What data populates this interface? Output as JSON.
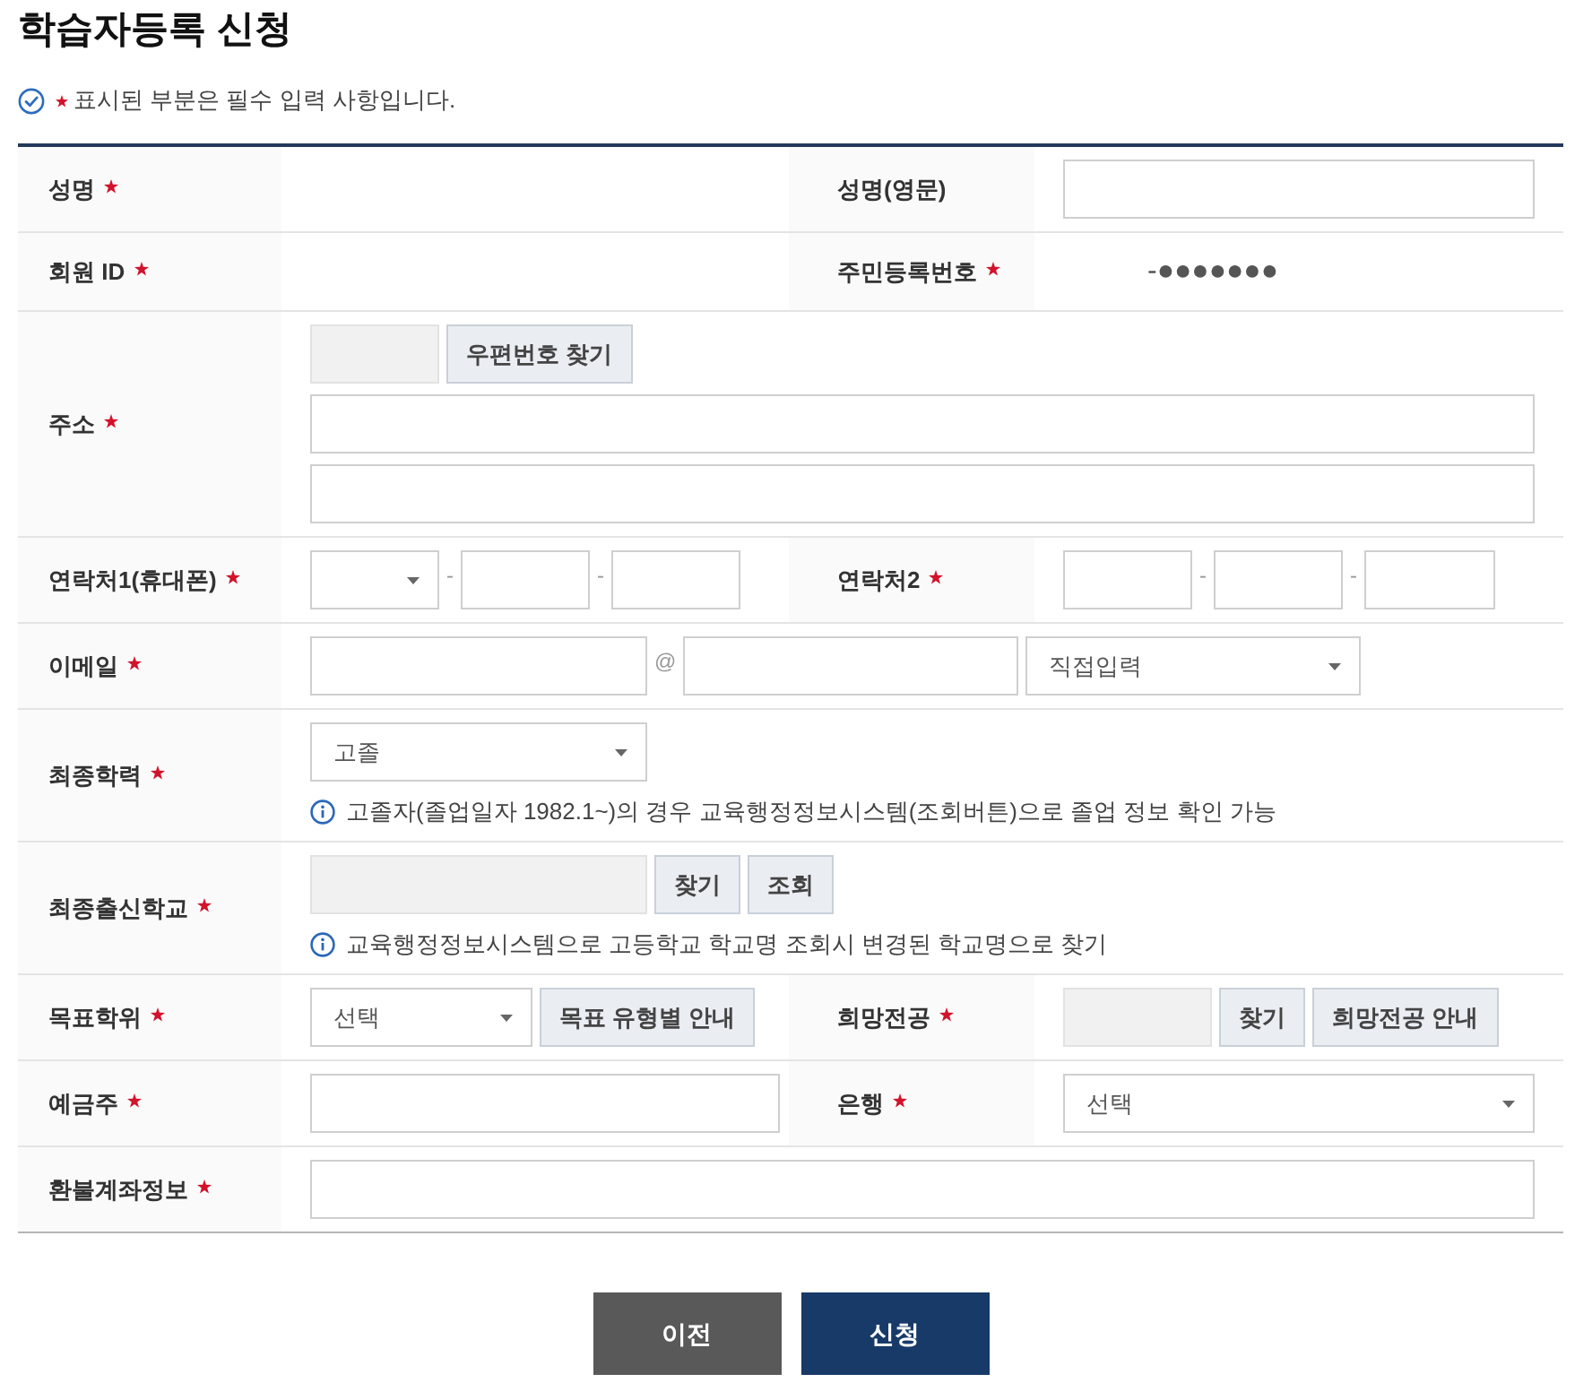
{
  "title": "학습자등록 신청",
  "notice": "표시된 부분은 필수 입력 사항입니다.",
  "rows": [
    {
      "fields": [
        {
          "label": "성명",
          "required": true
        },
        {
          "label": "성명(영문)",
          "required": false,
          "lines": [
            [
              {
                "kind": "input",
                "disabled": false
              }
            ]
          ]
        }
      ]
    },
    {
      "fields": [
        {
          "label": "회원 ID",
          "required": true
        },
        {
          "label": "주민등록번호",
          "required": true,
          "lines": [
            [
              {
                "kind": "text",
                "text": "-●●●●●●●"
              }
            ]
          ]
        }
      ]
    },
    {
      "fields": [
        {
          "label": "주소",
          "required": true,
          "lines": [
            [
              {
                "kind": "input",
                "disabled": true
              },
              {
                "kind": "button",
                "label": "우편번호 찾기"
              }
            ],
            [
              {
                "kind": "input",
                "disabled": false
              }
            ],
            [
              {
                "kind": "input",
                "disabled": false
              }
            ]
          ]
        }
      ]
    },
    {
      "fields": [
        {
          "label": "연락처1(휴대폰)",
          "required": true,
          "lines": [
            [
              {
                "kind": "select"
              },
              {
                "kind": "separator",
                "text": "-"
              },
              {
                "kind": "input",
                "disabled": false
              },
              {
                "kind": "separator",
                "text": "-"
              },
              {
                "kind": "input",
                "disabled": false
              }
            ]
          ]
        },
        {
          "label": "연락처2",
          "required": true,
          "lines": [
            [
              {
                "kind": "input",
                "disabled": false
              },
              {
                "kind": "separator",
                "text": "-"
              },
              {
                "kind": "input",
                "disabled": false
              },
              {
                "kind": "separator",
                "text": "-"
              },
              {
                "kind": "input",
                "disabled": false
              }
            ]
          ]
        }
      ]
    },
    {
      "fields": [
        {
          "label": "이메일",
          "required": true,
          "lines": [
            [
              {
                "kind": "input",
                "disabled": false
              },
              {
                "kind": "separator",
                "text": "@"
              },
              {
                "kind": "input",
                "disabled": false
              },
              {
                "kind": "select",
                "value": "직접입력"
              }
            ]
          ]
        }
      ]
    },
    {
      "fields": [
        {
          "label": "최종학력",
          "required": true,
          "lines": [
            [
              {
                "kind": "select",
                "value": "고졸"
              }
            ]
          ],
          "note": "고졸자(졸업일자 1982.1~)의 경우 교육행정정보시스템(조회버튼)으로 졸업 정보 확인 가능"
        }
      ]
    },
    {
      "fields": [
        {
          "label": "최종출신학교",
          "required": true,
          "lines": [
            [
              {
                "kind": "input",
                "disabled": true
              },
              {
                "kind": "button",
                "label": "찾기"
              },
              {
                "kind": "button",
                "label": "조회"
              }
            ]
          ],
          "note": "교육행정정보시스템으로 고등학교 학교명 조회시 변경된 학교명으로 찾기"
        }
      ]
    },
    {
      "fields": [
        {
          "label": "목표학위",
          "required": true,
          "lines": [
            [
              {
                "kind": "select",
                "value": "선택"
              },
              {
                "kind": "button",
                "label": "목표 유형별 안내"
              }
            ]
          ]
        },
        {
          "label": "희망전공",
          "required": true,
          "lines": [
            [
              {
                "kind": "input",
                "disabled": true
              },
              {
                "kind": "button",
                "label": "찾기"
              },
              {
                "kind": "button",
                "label": "희망전공 안내"
              }
            ]
          ]
        }
      ]
    },
    {
      "fields": [
        {
          "label": "예금주",
          "required": true,
          "lines": [
            [
              {
                "kind": "input",
                "disabled": false
              }
            ]
          ]
        },
        {
          "label": "은행",
          "required": true,
          "lines": [
            [
              {
                "kind": "select",
                "value": "선택"
              }
            ]
          ]
        }
      ]
    },
    {
      "fields": [
        {
          "label": "환불계좌정보",
          "required": true,
          "lines": [
            [
              {
                "kind": "input",
                "disabled": false
              }
            ]
          ]
        }
      ]
    }
  ],
  "buttons": [
    {
      "label": "이전",
      "kind": "secondary"
    },
    {
      "label": "신청",
      "kind": "primary"
    }
  ]
}
